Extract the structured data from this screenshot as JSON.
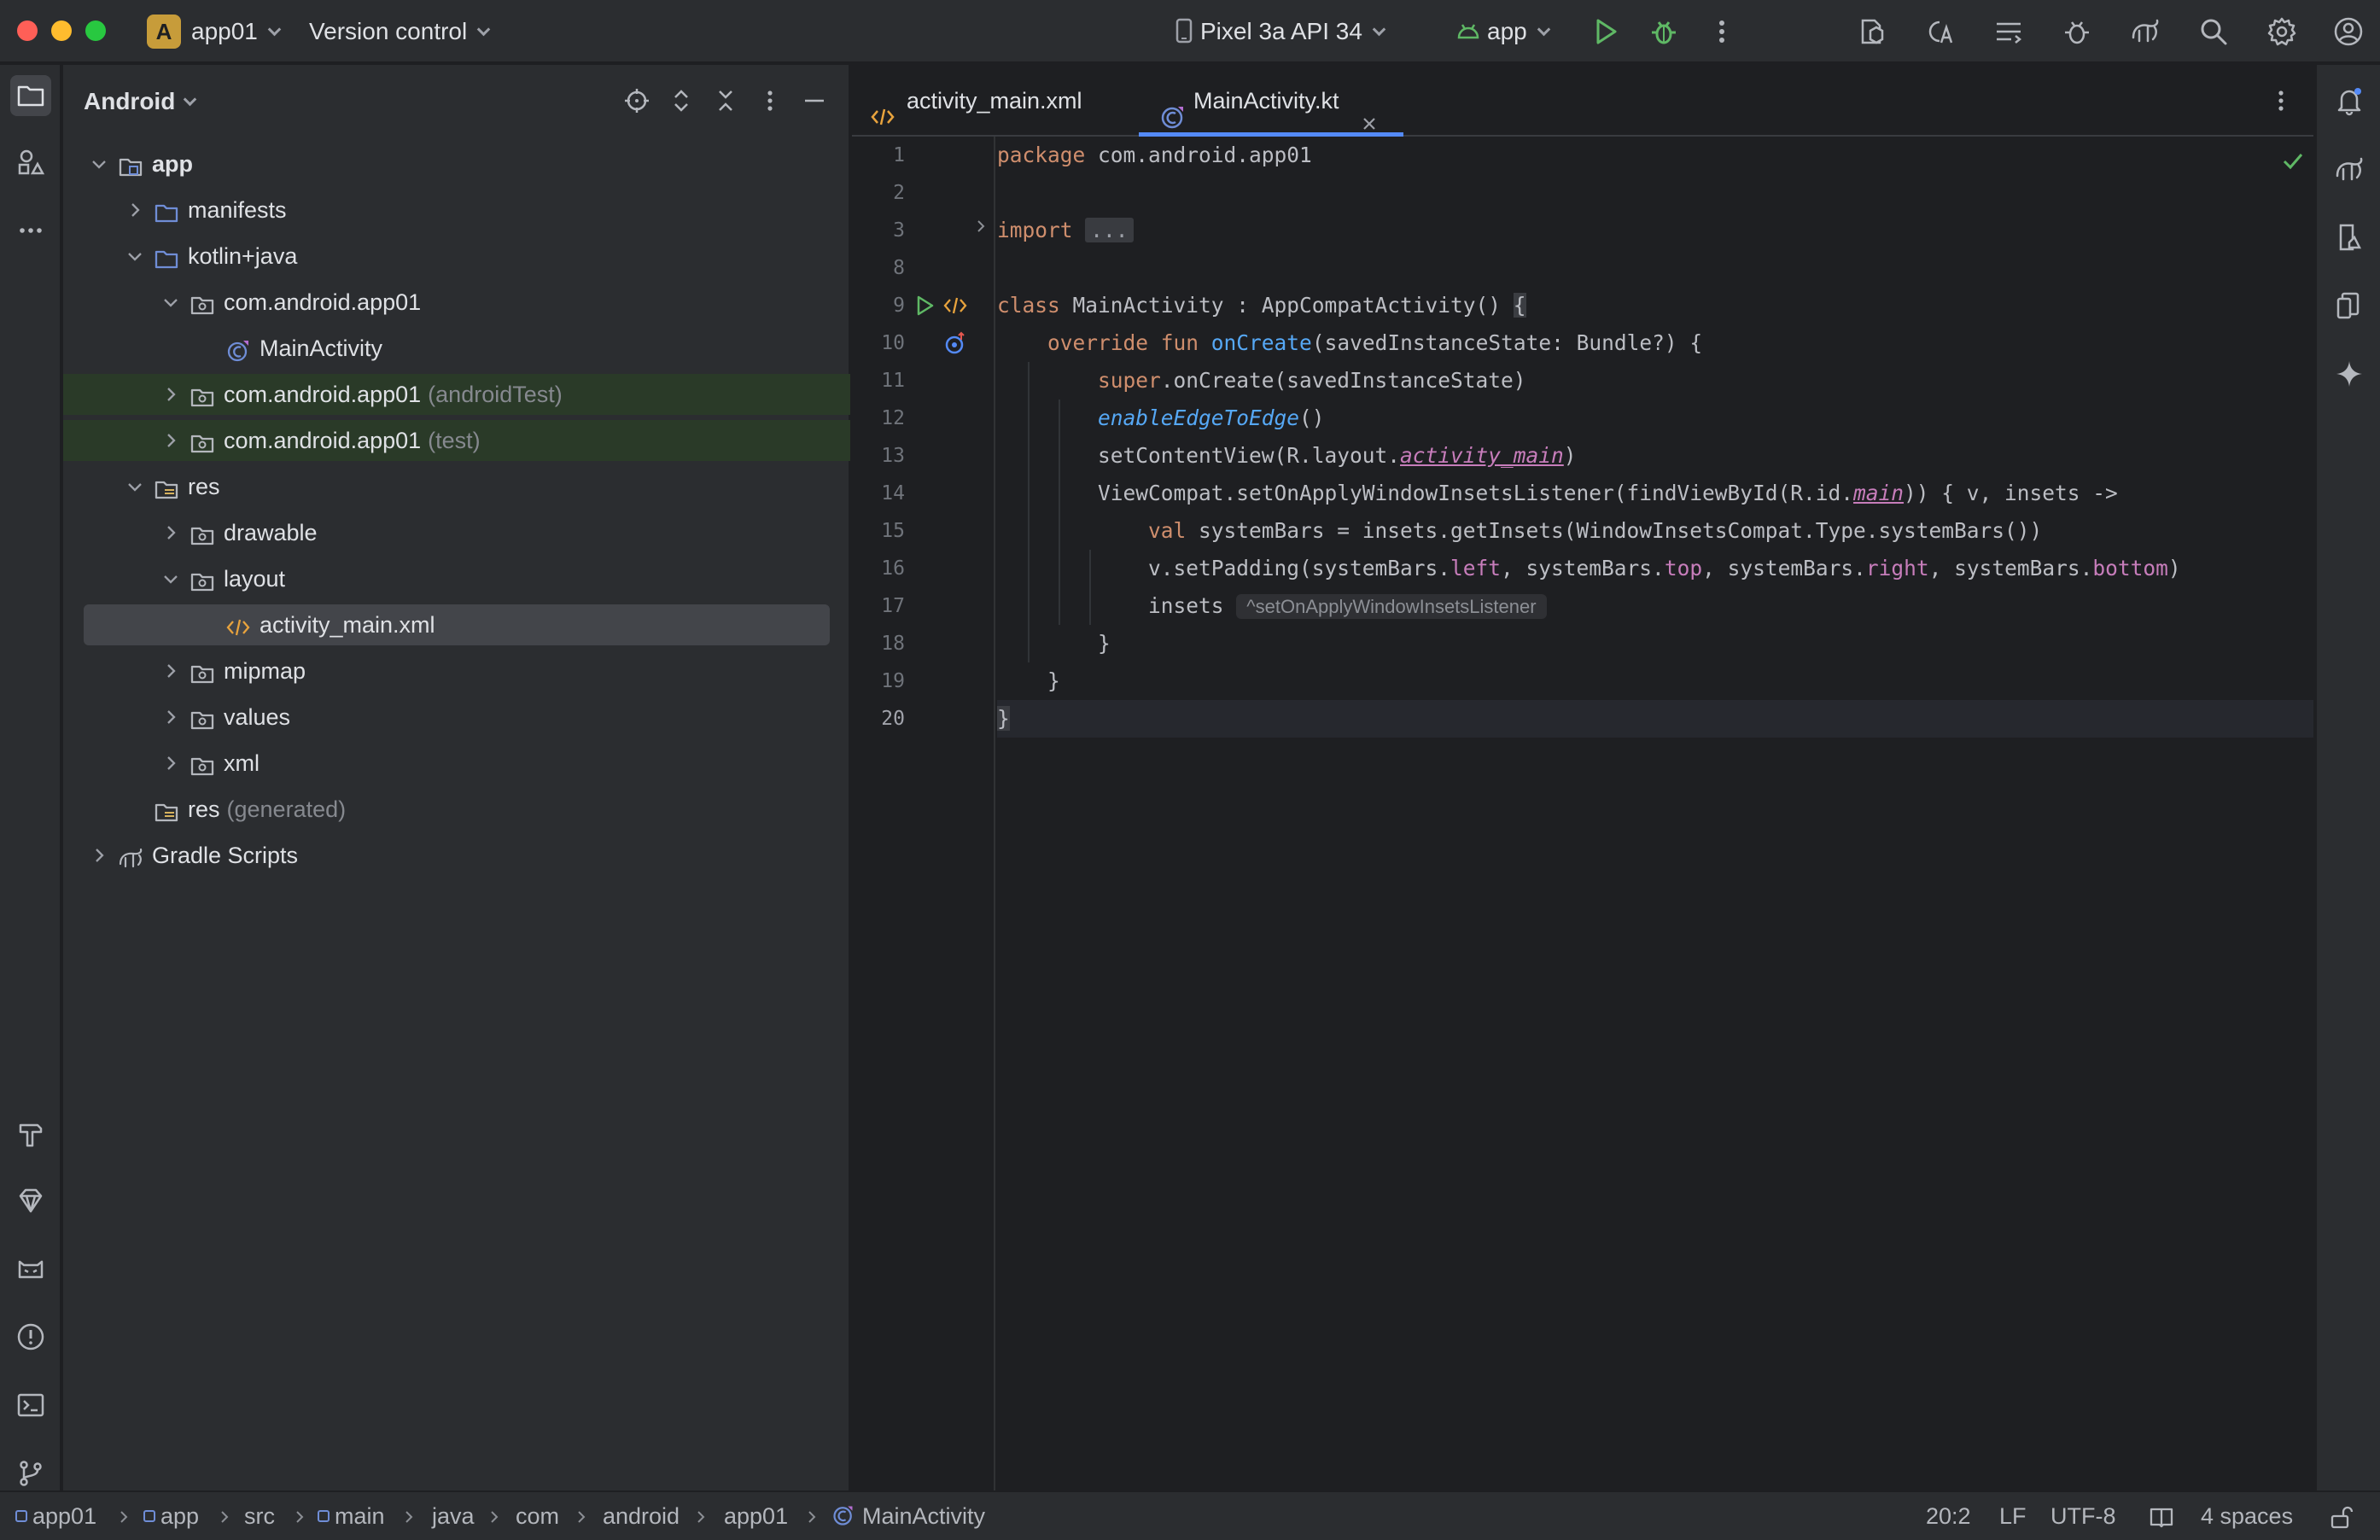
{
  "titlebar": {
    "project_badge": "A",
    "project_name": "app01",
    "vcs_label": "Version control",
    "device": "Pixel 3a API 34",
    "run_config": "app"
  },
  "project_panel": {
    "view_mode": "Android",
    "tree": [
      {
        "label": "app",
        "suffix": "",
        "level": 0,
        "expanded": true,
        "icon": "module-folder-icon"
      },
      {
        "label": "manifests",
        "suffix": "",
        "level": 1,
        "expanded": false,
        "icon": "folder-icon"
      },
      {
        "label": "kotlin+java",
        "suffix": "",
        "level": 1,
        "expanded": true,
        "icon": "folder-icon"
      },
      {
        "label": "com.android.app01",
        "suffix": "",
        "level": 2,
        "expanded": true,
        "icon": "package-icon"
      },
      {
        "label": "MainActivity",
        "suffix": "",
        "level": 3,
        "expanded": null,
        "icon": "kotlin-class-icon"
      },
      {
        "label": "com.android.app01",
        "suffix": "(androidTest)",
        "level": 2,
        "expanded": false,
        "icon": "package-icon"
      },
      {
        "label": "com.android.app01",
        "suffix": "(test)",
        "level": 2,
        "expanded": false,
        "icon": "package-icon"
      },
      {
        "label": "res",
        "suffix": "",
        "level": 1,
        "expanded": true,
        "icon": "resource-folder-icon"
      },
      {
        "label": "drawable",
        "suffix": "",
        "level": 2,
        "expanded": false,
        "icon": "package-icon"
      },
      {
        "label": "layout",
        "suffix": "",
        "level": 2,
        "expanded": true,
        "icon": "package-icon"
      },
      {
        "label": "activity_main.xml",
        "suffix": "",
        "level": 3,
        "expanded": null,
        "icon": "xml-file-icon"
      },
      {
        "label": "mipmap",
        "suffix": "",
        "level": 2,
        "expanded": false,
        "icon": "package-icon"
      },
      {
        "label": "values",
        "suffix": "",
        "level": 2,
        "expanded": false,
        "icon": "package-icon"
      },
      {
        "label": "xml",
        "suffix": "",
        "level": 2,
        "expanded": false,
        "icon": "package-icon"
      },
      {
        "label": "res",
        "suffix": "(generated)",
        "level": 1,
        "expanded": null,
        "icon": "resource-folder-icon"
      },
      {
        "label": "Gradle Scripts",
        "suffix": "",
        "level": 0,
        "expanded": false,
        "icon": "gradle-icon"
      }
    ]
  },
  "editor": {
    "tabs": [
      {
        "label": "activity_main.xml",
        "active": false
      },
      {
        "label": "MainActivity.kt",
        "active": true
      }
    ],
    "line_numbers": [
      "1",
      "2",
      "3",
      "8",
      "9",
      "10",
      "11",
      "12",
      "13",
      "14",
      "15",
      "16",
      "17",
      "18",
      "19",
      "20"
    ],
    "code": {
      "l1": [
        "package",
        " com.android.app01"
      ],
      "l3": [
        "import",
        "..."
      ],
      "l9": [
        "class",
        " MainActivity : AppCompatActivity() ",
        "{"
      ],
      "l10": [
        "override fun",
        "onCreate",
        "(savedInstanceState: Bundle?) {"
      ],
      "l11": [
        "super",
        ".onCreate(savedInstanceState)"
      ],
      "l12": [
        "enableEdgeToEdge",
        "()"
      ],
      "l13": [
        "setContentView(R.layout.",
        "activity_main",
        ")"
      ],
      "l14": [
        "ViewCompat.setOnApplyWindowInsetsListener(findViewById(R.id.",
        "main",
        ")) { v, insets ->"
      ],
      "l15": [
        "val",
        " systemBars = insets.getInsets(WindowInsetsCompat.Type.systemBars())"
      ],
      "l16": [
        "v.setPadding(systemBars.",
        "left",
        ", systemBars.",
        "top",
        ", systemBars.",
        "right",
        ", systemBars.",
        "bottom",
        ")"
      ],
      "l17": [
        "insets",
        "^setOnApplyWindowInsetsListener"
      ],
      "l18": [
        "}"
      ],
      "l19": [
        "}"
      ],
      "l20": [
        "}"
      ]
    }
  },
  "statusbar": {
    "breadcrumbs": [
      "app01",
      "app",
      "src",
      "main",
      "java",
      "com",
      "android",
      "app01",
      "MainActivity"
    ],
    "cursor": "20:2",
    "line_sep": "LF",
    "encoding": "UTF-8",
    "indent": "4 spaces"
  },
  "colors": {
    "accent": "#548af7",
    "keyword": "#cf8e6d",
    "function": "#56a8f5",
    "property": "#c77dbb",
    "run_green": "#5fb865"
  }
}
